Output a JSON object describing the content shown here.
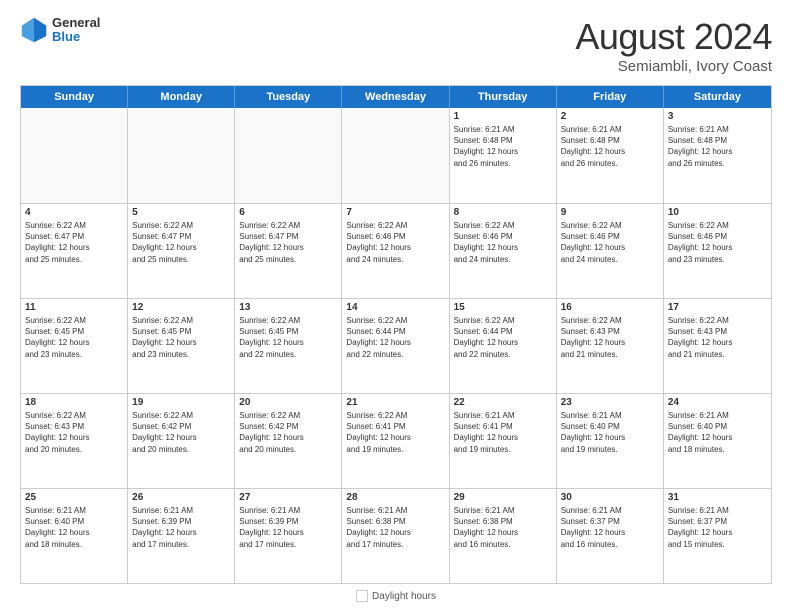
{
  "header": {
    "logo": {
      "general": "General",
      "blue": "Blue"
    },
    "title": "August 2024",
    "subtitle": "Semiambli, Ivory Coast"
  },
  "calendar": {
    "days": [
      "Sunday",
      "Monday",
      "Tuesday",
      "Wednesday",
      "Thursday",
      "Friday",
      "Saturday"
    ],
    "weeks": [
      [
        {
          "day": "",
          "info": ""
        },
        {
          "day": "",
          "info": ""
        },
        {
          "day": "",
          "info": ""
        },
        {
          "day": "",
          "info": ""
        },
        {
          "day": "1",
          "info": "Sunrise: 6:21 AM\nSunset: 6:48 PM\nDaylight: 12 hours\nand 26 minutes."
        },
        {
          "day": "2",
          "info": "Sunrise: 6:21 AM\nSunset: 6:48 PM\nDaylight: 12 hours\nand 26 minutes."
        },
        {
          "day": "3",
          "info": "Sunrise: 6:21 AM\nSunset: 6:48 PM\nDaylight: 12 hours\nand 26 minutes."
        }
      ],
      [
        {
          "day": "4",
          "info": "Sunrise: 6:22 AM\nSunset: 6:47 PM\nDaylight: 12 hours\nand 25 minutes."
        },
        {
          "day": "5",
          "info": "Sunrise: 6:22 AM\nSunset: 6:47 PM\nDaylight: 12 hours\nand 25 minutes."
        },
        {
          "day": "6",
          "info": "Sunrise: 6:22 AM\nSunset: 6:47 PM\nDaylight: 12 hours\nand 25 minutes."
        },
        {
          "day": "7",
          "info": "Sunrise: 6:22 AM\nSunset: 6:46 PM\nDaylight: 12 hours\nand 24 minutes."
        },
        {
          "day": "8",
          "info": "Sunrise: 6:22 AM\nSunset: 6:46 PM\nDaylight: 12 hours\nand 24 minutes."
        },
        {
          "day": "9",
          "info": "Sunrise: 6:22 AM\nSunset: 6:46 PM\nDaylight: 12 hours\nand 24 minutes."
        },
        {
          "day": "10",
          "info": "Sunrise: 6:22 AM\nSunset: 6:46 PM\nDaylight: 12 hours\nand 23 minutes."
        }
      ],
      [
        {
          "day": "11",
          "info": "Sunrise: 6:22 AM\nSunset: 6:45 PM\nDaylight: 12 hours\nand 23 minutes."
        },
        {
          "day": "12",
          "info": "Sunrise: 6:22 AM\nSunset: 6:45 PM\nDaylight: 12 hours\nand 23 minutes."
        },
        {
          "day": "13",
          "info": "Sunrise: 6:22 AM\nSunset: 6:45 PM\nDaylight: 12 hours\nand 22 minutes."
        },
        {
          "day": "14",
          "info": "Sunrise: 6:22 AM\nSunset: 6:44 PM\nDaylight: 12 hours\nand 22 minutes."
        },
        {
          "day": "15",
          "info": "Sunrise: 6:22 AM\nSunset: 6:44 PM\nDaylight: 12 hours\nand 22 minutes."
        },
        {
          "day": "16",
          "info": "Sunrise: 6:22 AM\nSunset: 6:43 PM\nDaylight: 12 hours\nand 21 minutes."
        },
        {
          "day": "17",
          "info": "Sunrise: 6:22 AM\nSunset: 6:43 PM\nDaylight: 12 hours\nand 21 minutes."
        }
      ],
      [
        {
          "day": "18",
          "info": "Sunrise: 6:22 AM\nSunset: 6:43 PM\nDaylight: 12 hours\nand 20 minutes."
        },
        {
          "day": "19",
          "info": "Sunrise: 6:22 AM\nSunset: 6:42 PM\nDaylight: 12 hours\nand 20 minutes."
        },
        {
          "day": "20",
          "info": "Sunrise: 6:22 AM\nSunset: 6:42 PM\nDaylight: 12 hours\nand 20 minutes."
        },
        {
          "day": "21",
          "info": "Sunrise: 6:22 AM\nSunset: 6:41 PM\nDaylight: 12 hours\nand 19 minutes."
        },
        {
          "day": "22",
          "info": "Sunrise: 6:21 AM\nSunset: 6:41 PM\nDaylight: 12 hours\nand 19 minutes."
        },
        {
          "day": "23",
          "info": "Sunrise: 6:21 AM\nSunset: 6:40 PM\nDaylight: 12 hours\nand 19 minutes."
        },
        {
          "day": "24",
          "info": "Sunrise: 6:21 AM\nSunset: 6:40 PM\nDaylight: 12 hours\nand 18 minutes."
        }
      ],
      [
        {
          "day": "25",
          "info": "Sunrise: 6:21 AM\nSunset: 6:40 PM\nDaylight: 12 hours\nand 18 minutes."
        },
        {
          "day": "26",
          "info": "Sunrise: 6:21 AM\nSunset: 6:39 PM\nDaylight: 12 hours\nand 17 minutes."
        },
        {
          "day": "27",
          "info": "Sunrise: 6:21 AM\nSunset: 6:39 PM\nDaylight: 12 hours\nand 17 minutes."
        },
        {
          "day": "28",
          "info": "Sunrise: 6:21 AM\nSunset: 6:38 PM\nDaylight: 12 hours\nand 17 minutes."
        },
        {
          "day": "29",
          "info": "Sunrise: 6:21 AM\nSunset: 6:38 PM\nDaylight: 12 hours\nand 16 minutes."
        },
        {
          "day": "30",
          "info": "Sunrise: 6:21 AM\nSunset: 6:37 PM\nDaylight: 12 hours\nand 16 minutes."
        },
        {
          "day": "31",
          "info": "Sunrise: 6:21 AM\nSunset: 6:37 PM\nDaylight: 12 hours\nand 15 minutes."
        }
      ]
    ]
  },
  "footer": {
    "legend_label": "Daylight hours"
  }
}
